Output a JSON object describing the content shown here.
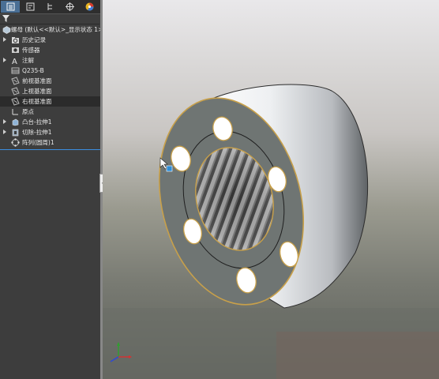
{
  "feature_manager": {
    "tabs": [
      {
        "icon": "feature-tree-icon",
        "active": true
      },
      {
        "icon": "property-manager-icon",
        "active": false
      },
      {
        "icon": "configuration-manager-icon",
        "active": false
      },
      {
        "icon": "dimxpert-icon",
        "active": false
      },
      {
        "icon": "display-manager-icon",
        "active": false
      }
    ],
    "filter_icon": "filter-icon",
    "root": {
      "label": "螺母 (默认<<默认>_显示状态 1>)",
      "icon": "part-icon"
    },
    "items": [
      {
        "label": "历史记录",
        "icon": "history-folder-icon",
        "expandable": true
      },
      {
        "label": "传感器",
        "icon": "sensor-icon",
        "expandable": false
      },
      {
        "label": "注解",
        "icon": "annotation-icon",
        "expandable": true
      },
      {
        "label": "Q235-B",
        "icon": "material-icon",
        "expandable": false
      },
      {
        "label": "前视基准面",
        "icon": "plane-icon",
        "expandable": false
      },
      {
        "label": "上视基准面",
        "icon": "plane-icon",
        "expandable": false
      },
      {
        "label": "右视基准面",
        "icon": "plane-icon",
        "expandable": false,
        "highlighted": true
      },
      {
        "label": "原点",
        "icon": "origin-icon",
        "expandable": false
      },
      {
        "label": "凸台-拉伸1",
        "icon": "boss-extrude-icon",
        "expandable": true
      },
      {
        "label": "切除-拉伸1",
        "icon": "cut-extrude-icon",
        "expandable": true
      },
      {
        "label": "阵列(圆周)1",
        "icon": "circular-pattern-icon",
        "expandable": false
      }
    ]
  },
  "colors": {
    "panel_bg": "#3d3d3d",
    "active_tab": "#4a6f95",
    "selection_line": "#3c8ee0",
    "part_face": "#6f7573",
    "part_edge": "#c8a04a"
  },
  "viewport": {
    "model": "nut-with-bolt-hole-pattern",
    "bolt_hole_count": 6,
    "triad_icon": "coordinate-triad-icon"
  }
}
